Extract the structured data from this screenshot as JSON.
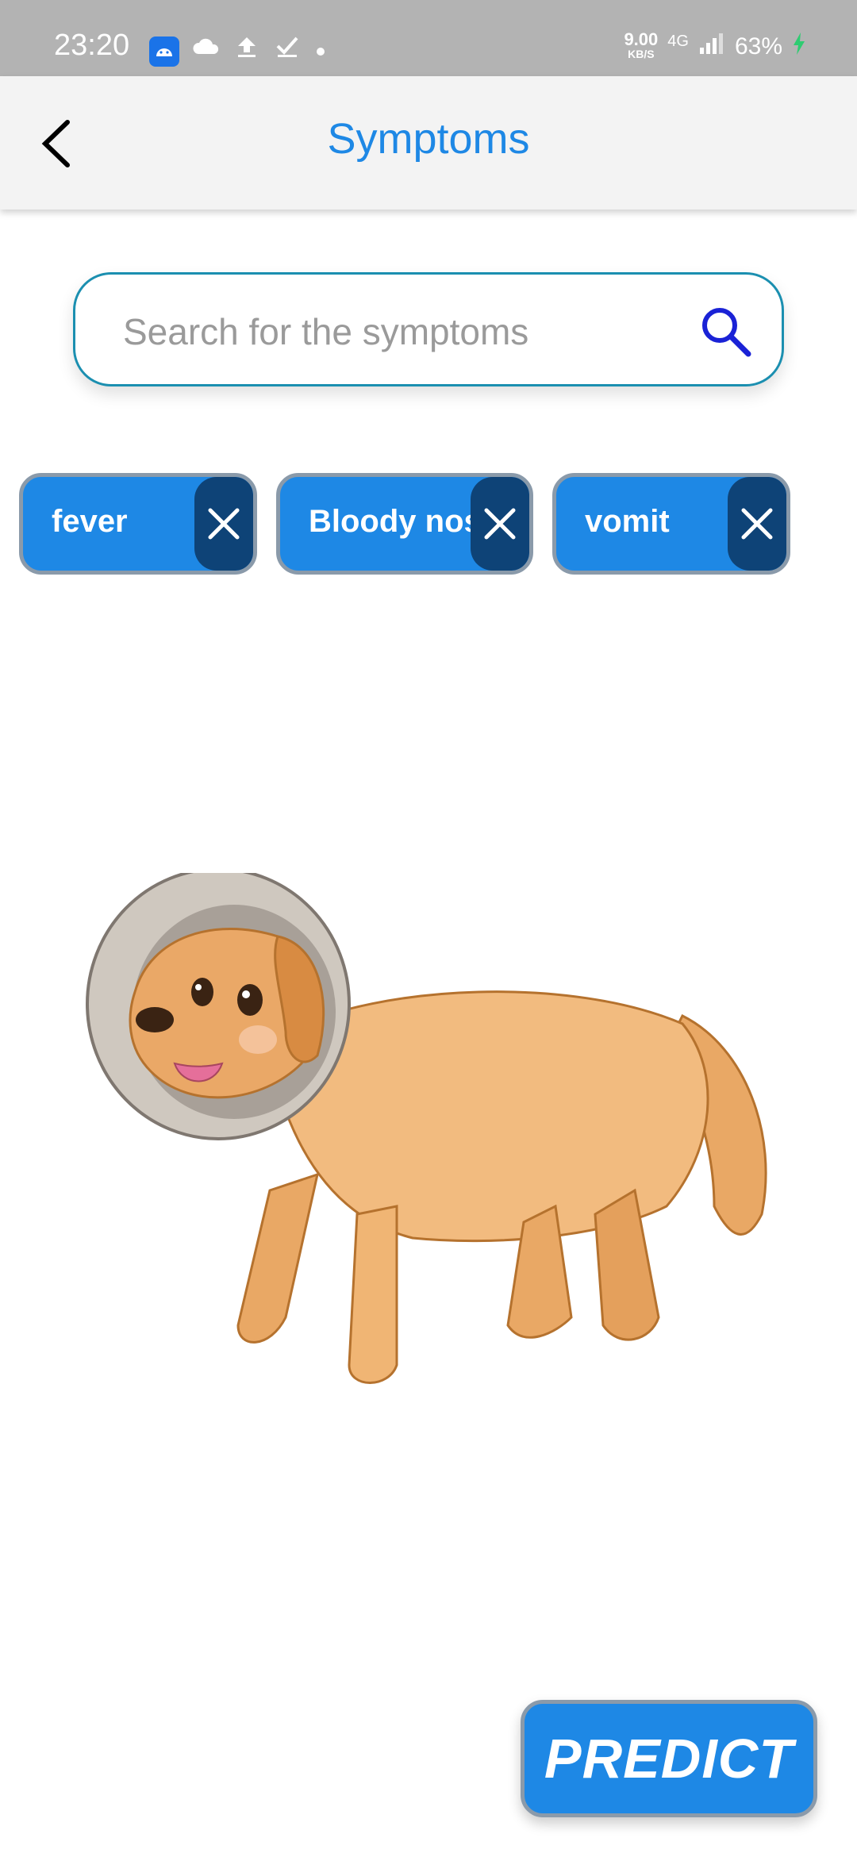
{
  "status_bar": {
    "time": "23:20",
    "speed_value": "9.00",
    "speed_unit": "KB/S",
    "network": "4G",
    "battery": "63%",
    "icons": [
      "android-icon",
      "cloud-icon",
      "upload-icon",
      "check-icon",
      "dot-icon",
      "signal-icon",
      "charging-icon"
    ]
  },
  "header": {
    "title": "Symptoms",
    "back_icon": "chevron-left-icon"
  },
  "search": {
    "placeholder": "Search for the symptoms",
    "value": "",
    "icon": "search-icon"
  },
  "chips": [
    {
      "label": "fever",
      "remove_icon": "close-icon"
    },
    {
      "label": "Bloody nose",
      "remove_icon": "close-icon"
    },
    {
      "label": "vomit",
      "remove_icon": "close-icon"
    }
  ],
  "illustration": {
    "description_icon": "dog-with-cone-illustration"
  },
  "predict_button": {
    "label": "PREDICT"
  },
  "colors": {
    "primary": "#1e88e5",
    "chip_close": "#0e4377",
    "status_bar": "#b3b3b3",
    "app_bar": "#f3f3f3",
    "search_border": "#1b8fb0",
    "search_icon": "#1a22d6"
  }
}
